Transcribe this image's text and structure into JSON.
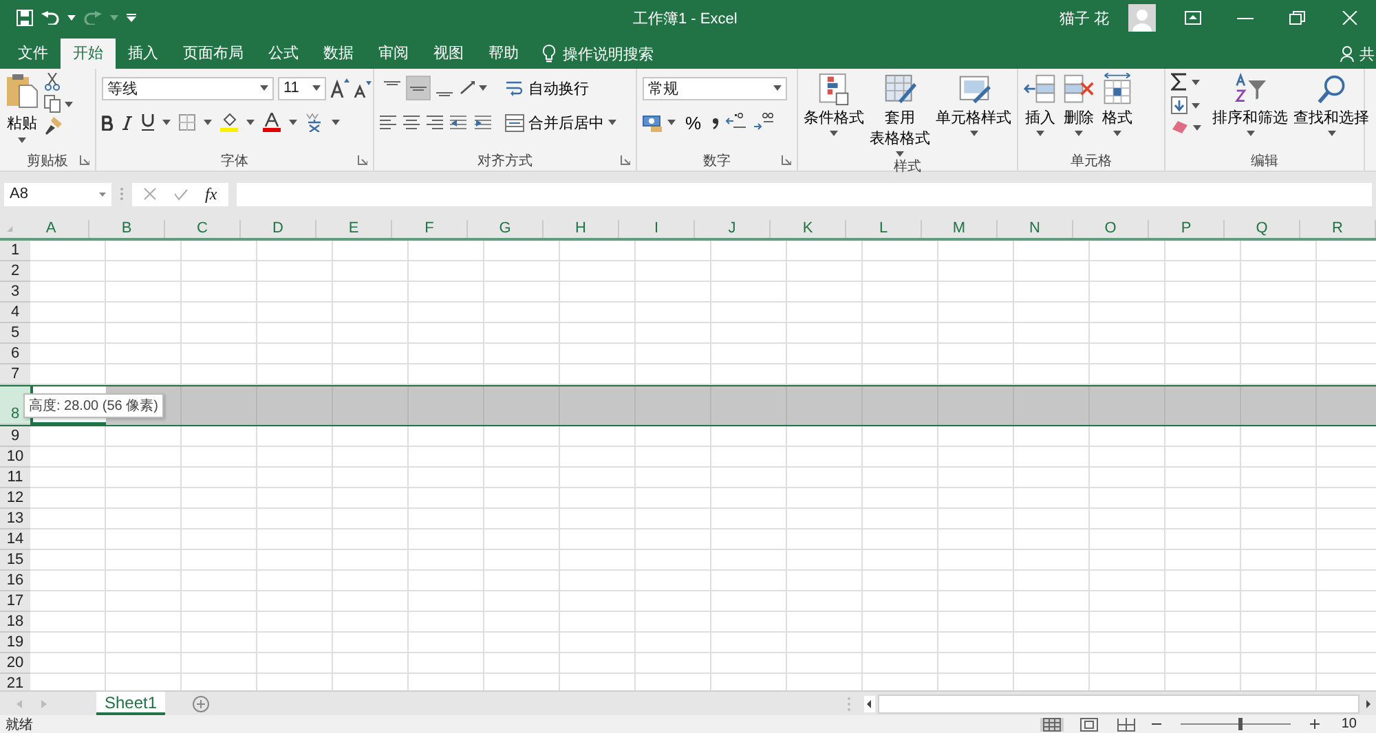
{
  "title_bar": {
    "title": "工作簿1  -  Excel",
    "user": "猫子 花"
  },
  "tabs": [
    {
      "label": "文件",
      "selected": false
    },
    {
      "label": "开始",
      "selected": true
    },
    {
      "label": "插入",
      "selected": false
    },
    {
      "label": "页面布局",
      "selected": false
    },
    {
      "label": "公式",
      "selected": false
    },
    {
      "label": "数据",
      "selected": false
    },
    {
      "label": "审阅",
      "selected": false
    },
    {
      "label": "视图",
      "selected": false
    },
    {
      "label": "帮助",
      "selected": false
    }
  ],
  "tell_me": "操作说明搜索",
  "share": "共",
  "ribbon": [
    {
      "kind": "clipboard",
      "label": "剪贴板",
      "paste": "粘贴"
    },
    {
      "kind": "font",
      "label": "字体",
      "font_name": "等线",
      "font_size": "11"
    },
    {
      "kind": "alignment",
      "label": "对齐方式",
      "vertical_align": [
        {
          "selected": false
        },
        {
          "selected": true
        },
        {
          "selected": false
        }
      ],
      "wrap_text": "自动换行",
      "merge_center": "合并后居中"
    },
    {
      "kind": "number",
      "label": "数字",
      "format": "常规",
      "percent": "%"
    },
    {
      "kind": "styles",
      "label": "样式",
      "buttons": [
        {
          "lines": [
            "条件格式"
          ]
        },
        {
          "lines": [
            "套用",
            "表格格式"
          ]
        },
        {
          "lines": [
            "单元格样式"
          ]
        }
      ]
    },
    {
      "kind": "cells",
      "label": "单元格",
      "buttons": [
        {
          "lines": [
            "插入"
          ]
        },
        {
          "lines": [
            "删除"
          ]
        },
        {
          "lines": [
            "格式"
          ]
        }
      ]
    },
    {
      "kind": "editing",
      "label": "编辑",
      "buttons": [
        {
          "lines": [
            "排序和筛选"
          ]
        },
        {
          "lines": [
            "查找和选择"
          ]
        }
      ]
    }
  ],
  "formula_bar": {
    "name_box": "A8",
    "function_symbol": "fx"
  },
  "columns": [
    "A",
    "B",
    "C",
    "D",
    "E",
    "F",
    "G",
    "H",
    "I",
    "J",
    "K",
    "L",
    "M",
    "N",
    "O",
    "P",
    "Q",
    "R"
  ],
  "rows": [
    {
      "label": "1",
      "kind": "normal",
      "selected": false
    },
    {
      "label": "2",
      "kind": "normal",
      "selected": false
    },
    {
      "label": "3",
      "kind": "normal",
      "selected": false
    },
    {
      "label": "4",
      "kind": "normal",
      "selected": false
    },
    {
      "label": "5",
      "kind": "normal",
      "selected": false
    },
    {
      "label": "6",
      "kind": "normal",
      "selected": false
    },
    {
      "label": "7",
      "kind": "normal",
      "selected": false
    },
    {
      "label": "8",
      "kind": "tall",
      "selected": true
    },
    {
      "label": "9",
      "kind": "normal",
      "selected": false
    },
    {
      "label": "10",
      "kind": "normal",
      "selected": false
    },
    {
      "label": "11",
      "kind": "normal",
      "selected": false
    },
    {
      "label": "12",
      "kind": "normal",
      "selected": false
    },
    {
      "label": "13",
      "kind": "normal",
      "selected": false
    },
    {
      "label": "14",
      "kind": "normal",
      "selected": false
    },
    {
      "label": "15",
      "kind": "normal",
      "selected": false
    },
    {
      "label": "16",
      "kind": "normal",
      "selected": false
    },
    {
      "label": "17",
      "kind": "normal",
      "selected": false
    },
    {
      "label": "18",
      "kind": "normal",
      "selected": false
    },
    {
      "label": "19",
      "kind": "normal",
      "selected": false
    },
    {
      "label": "20",
      "kind": "normal",
      "selected": false
    },
    {
      "label": "21",
      "kind": "normal",
      "selected": false
    }
  ],
  "row_height_tooltip": "高度: 28.00 (56 像素)",
  "sheet_tabs": [
    {
      "label": "Sheet1",
      "selected": true
    }
  ],
  "status_bar": {
    "status": "就绪",
    "views": [
      {
        "selected": true
      },
      {
        "selected": false
      },
      {
        "selected": false
      }
    ],
    "zoom_slider": {
      "level": 0.53
    },
    "zoom": "10"
  }
}
